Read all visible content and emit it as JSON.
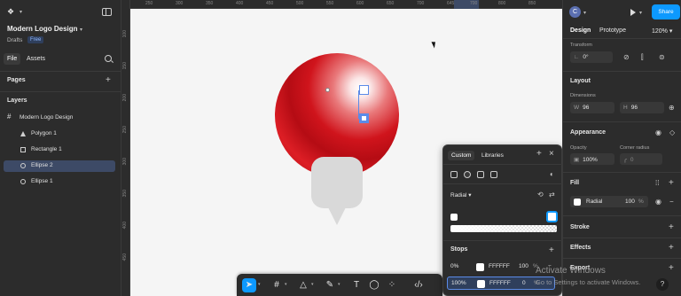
{
  "left_panel": {
    "file_title": "Modern Logo Design",
    "project": "Drafts",
    "plan_badge": "Free",
    "tabs": [
      "File",
      "Assets"
    ],
    "pages_heading": "Pages",
    "layers_heading": "Layers",
    "layers": [
      {
        "name": "Modern Logo Design",
        "icon": "frame-icon"
      },
      {
        "name": "Polygon 1",
        "icon": "polygon-icon"
      },
      {
        "name": "Rectangle 1",
        "icon": "rectangle-icon"
      },
      {
        "name": "Ellipse 2",
        "icon": "ellipse-icon",
        "selected": true
      },
      {
        "name": "Ellipse 1",
        "icon": "ellipse-icon"
      }
    ]
  },
  "canvas": {
    "ruler_ticks": [
      "250",
      "300",
      "350",
      "400",
      "450",
      "500",
      "550",
      "600",
      "650",
      "700",
      "750",
      "800",
      "850"
    ],
    "ruler_selected": [
      "645",
      "700"
    ],
    "v_ticks": [
      "100",
      "150",
      "200",
      "250",
      "300",
      "350",
      "400",
      "450"
    ]
  },
  "color_picker": {
    "tabs": [
      "Custom",
      "Libraries"
    ],
    "gradient_type": "Radial",
    "stops_heading": "Stops",
    "stops": [
      {
        "position": "0%",
        "hex": "FFFFFF",
        "opacity": "100",
        "unit": "%"
      },
      {
        "position": "100%",
        "hex": "FFFFFF",
        "opacity": "0",
        "unit": "%"
      }
    ]
  },
  "right_panel": {
    "avatar_letter": "C",
    "share_label": "Share",
    "tabs": [
      "Design",
      "Prototype"
    ],
    "zoom": "120%",
    "transform_heading": "Transform",
    "rotation": "0°",
    "layout_heading": "Layout",
    "dimensions_label": "Dimensions",
    "width_key": "W",
    "width": "96",
    "height_key": "H",
    "height": "96",
    "appearance_heading": "Appearance",
    "opacity_label": "Opacity",
    "opacity": "100%",
    "corner_radius_label": "Corner radius",
    "corner_radius": "0",
    "fill_heading": "Fill",
    "fill_type": "Radial",
    "fill_opacity": "100",
    "fill_unit": "%",
    "stroke_heading": "Stroke",
    "effects_heading": "Effects",
    "export_heading": "Export"
  },
  "overlay": {
    "activate_title": "Activate Windows",
    "activate_sub": "Go to Settings to activate Windows.",
    "help": "?"
  },
  "colors": {
    "accent": "#0d99ff",
    "selection": "#3d4a66",
    "panel_bg": "#2c2c2c",
    "canvas_bg": "#f5f5f5",
    "ball_red": "#d0141c",
    "bulb_gray": "#d9d9d9"
  }
}
